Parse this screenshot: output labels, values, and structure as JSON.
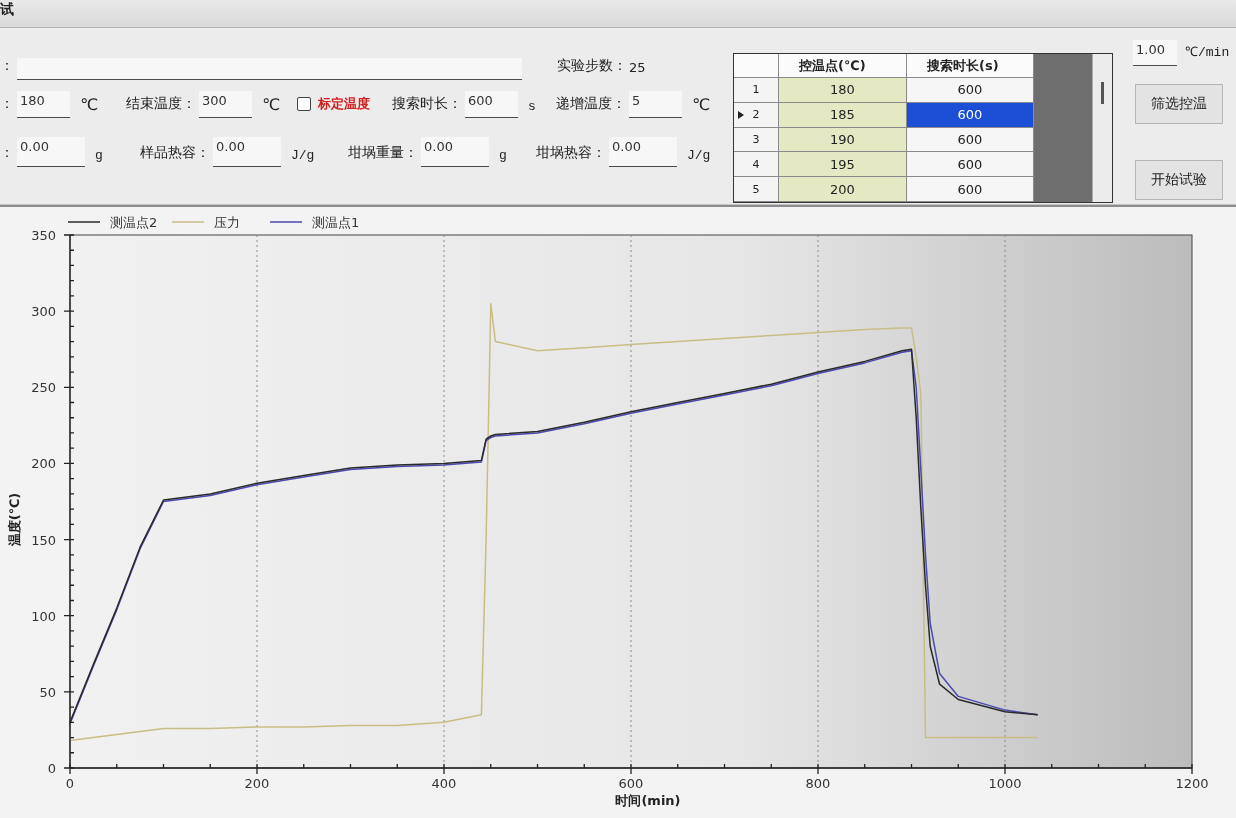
{
  "window": {
    "title": "试"
  },
  "form": {
    "name_field": {
      "label": "："
    },
    "step_count": {
      "label": "实验步数：",
      "value": "25"
    },
    "rows": [
      {
        "items": [
          {
            "kind": "field",
            "label": "：",
            "value": "180",
            "unit": "℃"
          },
          {
            "kind": "field",
            "label": "结束温度：",
            "value": "300",
            "unit": "℃"
          },
          {
            "kind": "checkbox",
            "label": "标定温度",
            "checked": false
          },
          {
            "kind": "field",
            "label": "搜索时长：",
            "value": "600",
            "unit": "s"
          },
          {
            "kind": "field",
            "label": "递增温度：",
            "value": "5",
            "unit": "℃"
          }
        ]
      },
      {
        "items": [
          {
            "kind": "field",
            "label": "：",
            "value": "0.00",
            "unit": "g"
          },
          {
            "kind": "field",
            "label": "样品热容：",
            "value": "0.00",
            "unit": "J/g"
          },
          {
            "kind": "field",
            "label": "坩埚重量：",
            "value": "0.00",
            "unit": "g"
          },
          {
            "kind": "field",
            "label": "坩埚热容：",
            "value": "0.00",
            "unit": "J/g"
          }
        ]
      }
    ]
  },
  "control_table": {
    "columns": [
      "控温点(℃)",
      "搜索时长(s)"
    ],
    "rows": [
      {
        "number": "1",
        "control_temp": "180",
        "search_time": "600",
        "selected": false
      },
      {
        "number": "2",
        "control_temp": "185",
        "search_time": "600",
        "selected": true
      },
      {
        "number": "3",
        "control_temp": "190",
        "search_time": "600",
        "selected": false
      },
      {
        "number": "4",
        "control_temp": "195",
        "search_time": "600",
        "selected": false
      },
      {
        "number": "5",
        "control_temp": "200",
        "search_time": "600",
        "selected": false
      }
    ]
  },
  "rate_field": {
    "value": "1.00",
    "unit": "℃/min"
  },
  "buttons": [
    "筛选控温",
    "开始试验"
  ],
  "chart": {
    "chart_data": {
      "type": "line",
      "xlabel": "时间(min)",
      "ylabel": "温度(℃)",
      "x": [
        0,
        25,
        50,
        75,
        100,
        150,
        200,
        250,
        300,
        350,
        400,
        440,
        445,
        450,
        455,
        500,
        550,
        600,
        650,
        700,
        750,
        800,
        850,
        890,
        900,
        905,
        910,
        915,
        920,
        930,
        950,
        1000,
        1035
      ],
      "series": [
        {
          "name": "测温点2",
          "color": "#2a2a2a",
          "values": [
            30,
            68,
            105,
            145,
            176,
            180,
            187,
            192,
            197,
            199,
            200,
            202,
            216,
            218,
            219,
            221,
            227,
            234,
            240,
            246,
            252,
            260,
            267,
            274,
            275,
            230,
            170,
            120,
            80,
            55,
            45,
            37,
            35
          ]
        },
        {
          "name": "压力",
          "color": "#c9bd86",
          "values": [
            18,
            20,
            22,
            24,
            26,
            26,
            27,
            27,
            28,
            28,
            30,
            35,
            150,
            305,
            280,
            274,
            276,
            278,
            280,
            282,
            284,
            286,
            288,
            289,
            289,
            270,
            245,
            20,
            20,
            20,
            20,
            20,
            20
          ]
        },
        {
          "name": "测温点1",
          "color": "#4a4ab0",
          "values": [
            29,
            67,
            104,
            144,
            175,
            179,
            186,
            191,
            196,
            198,
            199,
            201,
            215,
            217,
            218,
            220,
            226,
            233,
            239,
            245,
            251,
            259,
            266,
            273,
            274,
            250,
            195,
            140,
            95,
            62,
            47,
            38,
            35
          ]
        }
      ],
      "xlim": [
        0,
        1200
      ],
      "ylim": [
        0,
        350
      ],
      "xticks": [
        {
          "value": 0,
          "label": "0"
        },
        {
          "value": 200,
          "label": "200"
        },
        {
          "value": 400,
          "label": "400"
        },
        {
          "value": 600,
          "label": "600"
        },
        {
          "value": 800,
          "label": "800"
        },
        {
          "value": 1000,
          "label": "1000"
        },
        {
          "value": 1200,
          "label": "1200"
        }
      ],
      "yticks": [
        {
          "value": 0,
          "label": "0"
        },
        {
          "value": 50,
          "label": "50"
        },
        {
          "value": 100,
          "label": "100"
        },
        {
          "value": 150,
          "label": "150"
        },
        {
          "value": 200,
          "label": "200"
        },
        {
          "value": 250,
          "label": "250"
        },
        {
          "value": 300,
          "label": "300"
        },
        {
          "value": 350,
          "label": "350"
        }
      ],
      "grid": true,
      "legend": true
    }
  }
}
